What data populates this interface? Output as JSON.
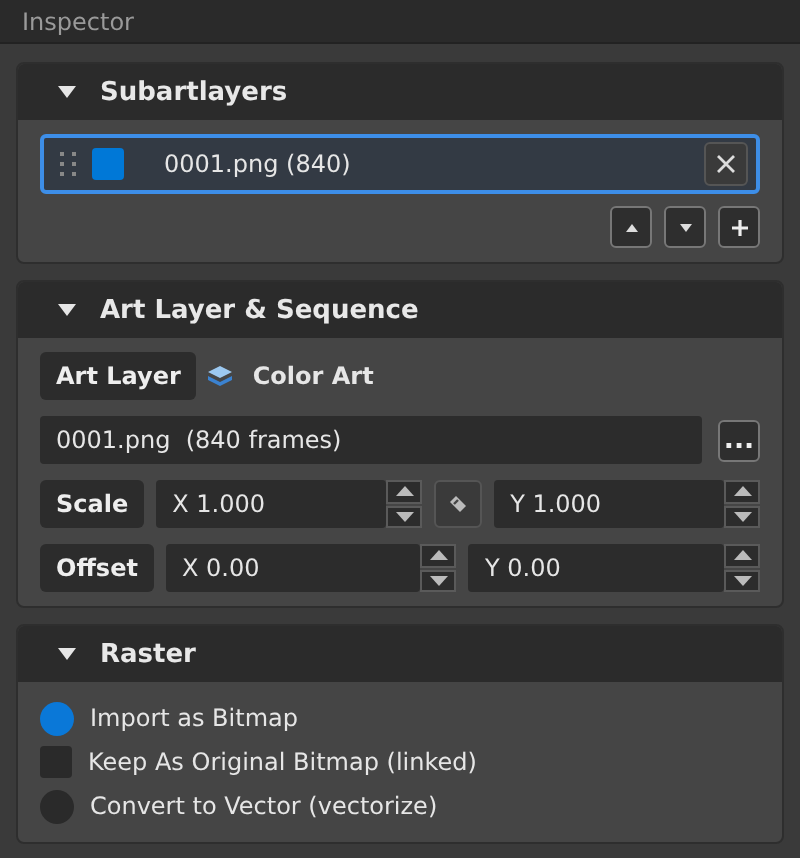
{
  "window": {
    "title": "Inspector"
  },
  "subartlayers": {
    "title": "Subartlayers",
    "expanded": true,
    "items": [
      {
        "label": "0001.png  (840)",
        "color": "#0078d7",
        "selected": true
      }
    ]
  },
  "art_layer": {
    "title": "Art Layer & Sequence",
    "expanded": true,
    "layer_button": "Art Layer",
    "layer_name": "Color Art",
    "sequence": "0001.png  (840 frames)",
    "browse": "...",
    "scale": {
      "label": "Scale",
      "x": "X 1.000",
      "y": "Y 1.000"
    },
    "offset": {
      "label": "Offset",
      "x": "X 0.00",
      "y": "Y 0.00"
    }
  },
  "raster": {
    "title": "Raster",
    "expanded": true,
    "options": [
      {
        "kind": "radio",
        "label": "Import as Bitmap",
        "selected": true
      },
      {
        "kind": "checkbox",
        "label": "Keep As Original Bitmap (linked)",
        "selected": false
      },
      {
        "kind": "radio",
        "label": "Convert to Vector (vectorize)",
        "selected": false
      }
    ]
  }
}
